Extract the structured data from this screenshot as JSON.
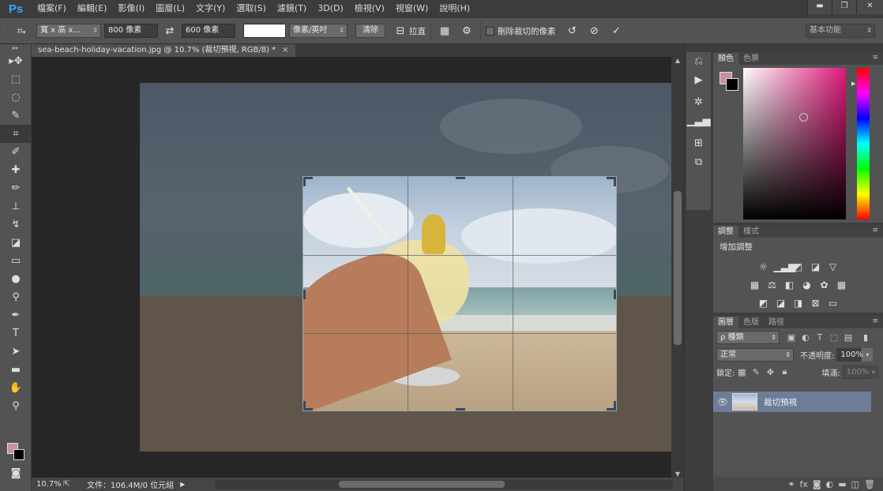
{
  "app": {
    "logo": "Ps"
  },
  "menu": [
    "檔案(F)",
    "編輯(E)",
    "影像(I)",
    "圖層(L)",
    "文字(Y)",
    "選取(S)",
    "濾鏡(T)",
    "3D(D)",
    "檢視(V)",
    "視窗(W)",
    "說明(H)"
  ],
  "window_controls": {
    "minimize": "▬",
    "restore": "❐",
    "close": "✕"
  },
  "options": {
    "ratio_select": "寬 x 高 x...",
    "width_value": "800 像素",
    "swap_icon": "⇄",
    "height_value": "600 像素",
    "resolution_value": "",
    "unit_select": "像素/英吋",
    "clear_button": "清除",
    "straighten_label": "拉直",
    "delete_pixels_label": "刪除裁切的像素",
    "workspace_select": "基本功能"
  },
  "document": {
    "tab_title": "sea-beach-holiday-vacation.jpg @ 10.7% (裁切預視, RGB/8) *",
    "close": "×"
  },
  "status": {
    "zoom": "10.7%",
    "doc_info": "文件：106.4M/0 位元組"
  },
  "panels": {
    "color_tabs": [
      "顏色",
      "色票"
    ],
    "adjust_tabs": [
      "調整",
      "樣式"
    ],
    "adjust_title": "增加調整",
    "layers_tabs": [
      "圖層",
      "色版",
      "路徑"
    ],
    "kind_select": "ρ 種類",
    "blend_mode": "正常",
    "opacity_label": "不透明度:",
    "opacity_value": "100%",
    "lock_label": "鎖定:",
    "fill_label": "填滿:",
    "fill_value": "100%",
    "layer_name": "裁切預視"
  },
  "colors": {
    "foreground": "#c78fa8",
    "background": "#000000",
    "ps_blue": "#31a8ff",
    "selected_layer": "#6d7d99"
  }
}
